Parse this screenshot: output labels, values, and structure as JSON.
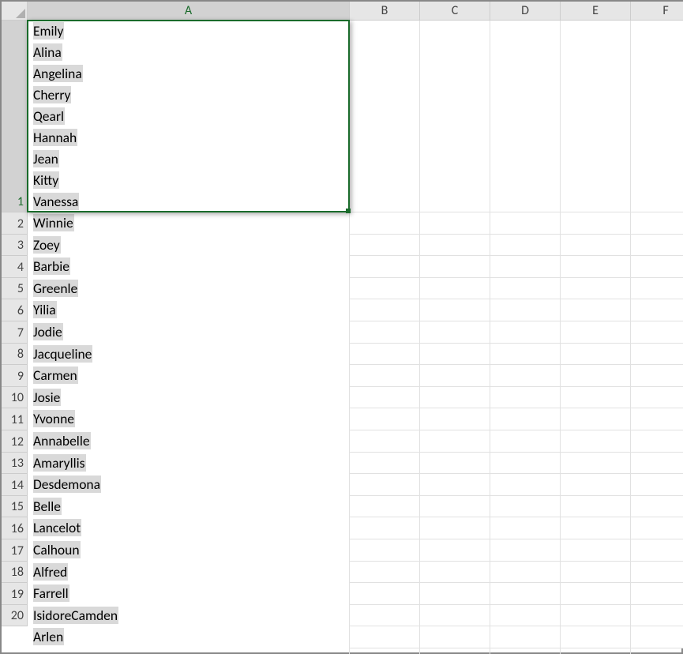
{
  "columns": [
    "A",
    "B",
    "C",
    "D",
    "E",
    "F"
  ],
  "selected_column_index": 0,
  "active_cell": "A1",
  "active_row_index": 0,
  "a1_lines": [
    "Emily",
    "Alina",
    "Angelina",
    "Cherry",
    "Qearl",
    "Hannah",
    "Jean",
    "Kitty",
    "Vanessa"
  ],
  "row_count": 20,
  "rows_remaining": [
    "Winnie",
    "Zoey",
    "Barbie",
    "Greenle",
    "Yilia",
    "Jodie",
    "Jacqueline",
    "Carmen",
    "Josie",
    "Yvonne",
    "Annabelle",
    "Amaryllis",
    "Desdemona",
    "Belle",
    "Lancelot",
    "Calhoun",
    "Alfred",
    "Farrell",
    "IsidoreCamden",
    "Arlen"
  ],
  "colors": {
    "selection_border": "#1a6b2b",
    "header_bg": "#e6e6e6",
    "header_selected_bg": "#d2d2d2",
    "highlight_bg": "#d9d9d9"
  }
}
